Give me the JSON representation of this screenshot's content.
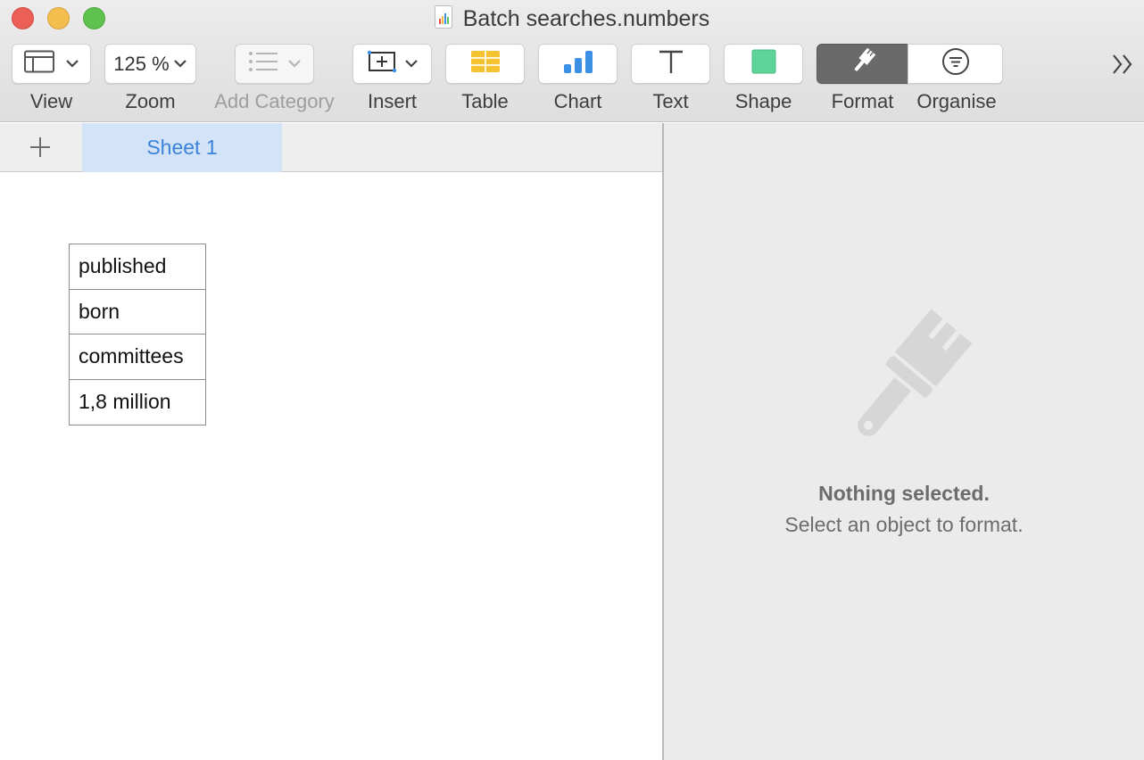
{
  "window": {
    "title": "Batch searches.numbers"
  },
  "toolbar": {
    "view_label": "View",
    "zoom_value": "125 %",
    "zoom_label": "Zoom",
    "add_category_label": "Add Category",
    "insert_label": "Insert",
    "table_label": "Table",
    "chart_label": "Chart",
    "text_label": "Text",
    "shape_label": "Shape",
    "format_label": "Format",
    "organise_label": "Organise"
  },
  "sheets": {
    "tabs": [
      {
        "label": "Sheet 1",
        "active": true
      }
    ]
  },
  "table": {
    "cells": [
      "published",
      "born",
      "committees",
      "1,8 million"
    ]
  },
  "inspector": {
    "title": "Nothing selected.",
    "subtitle": "Select an object to format."
  },
  "colors": {
    "active_tab_bg": "#d3e4f8",
    "active_tab_text": "#3a83d8",
    "chart_icon_blue": "#3b8fe4",
    "table_icon_yellow": "#f5c232",
    "shape_icon_green": "#5fd49a"
  },
  "icons": [
    "sidebar-view-icon",
    "chevron-down-icon",
    "list-icon",
    "insert-box-icon",
    "table-icon",
    "bar-chart-icon",
    "text-t-icon",
    "shape-square-icon",
    "paintbrush-icon",
    "filter-icon",
    "double-chevron-right-icon",
    "plus-icon"
  ]
}
